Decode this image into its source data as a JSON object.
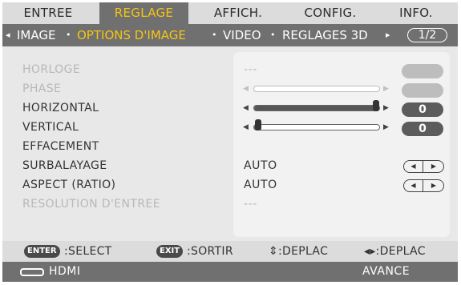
{
  "tabs": [
    {
      "label": "ENTREE"
    },
    {
      "label": "REGLAGE"
    },
    {
      "label": "AFFICH."
    },
    {
      "label": "CONFIG."
    },
    {
      "label": "INFO."
    }
  ],
  "submenu": {
    "left_arrow": "◂",
    "right_arrow": "▸",
    "bullet": "•",
    "items": [
      {
        "label": "IMAGE"
      },
      {
        "label": "OPTIONS D'IMAGE"
      },
      {
        "label": "VIDEO"
      },
      {
        "label": "REGLAGES 3D"
      }
    ],
    "page": "1/2"
  },
  "rows": {
    "horloge": {
      "label": "HORLOGE",
      "value": "---"
    },
    "phase": {
      "label": "PHASE"
    },
    "horizontal": {
      "label": "HORIZONTAL",
      "value": "0",
      "level": 0.97
    },
    "vertical": {
      "label": "VERTICAL",
      "value": "0",
      "level": 0.04
    },
    "effacement": {
      "label": "EFFACEMENT"
    },
    "surbalayage": {
      "label": "SURBALAYAGE",
      "value": "AUTO"
    },
    "aspect": {
      "label": "ASPECT (RATIO)",
      "value": "AUTO"
    },
    "resolution": {
      "label": "RESOLUTION D'ENTREE",
      "value": "---"
    }
  },
  "lr_glyphs": {
    "left": "◀",
    "right": "▶"
  },
  "footer": {
    "enter_key": "ENTER",
    "enter_text": ":SELECT",
    "exit_key": "EXIT",
    "exit_text": ":SORTIR",
    "updown_text": "⇕:DEPLAC",
    "leftright_text": "◂▸:DEPLAC"
  },
  "status": {
    "source": "HDMI",
    "mode": "AVANCE"
  },
  "colors": {
    "accent": "#f6c510",
    "bar": "#707070",
    "panel": "#e8e8e8"
  }
}
